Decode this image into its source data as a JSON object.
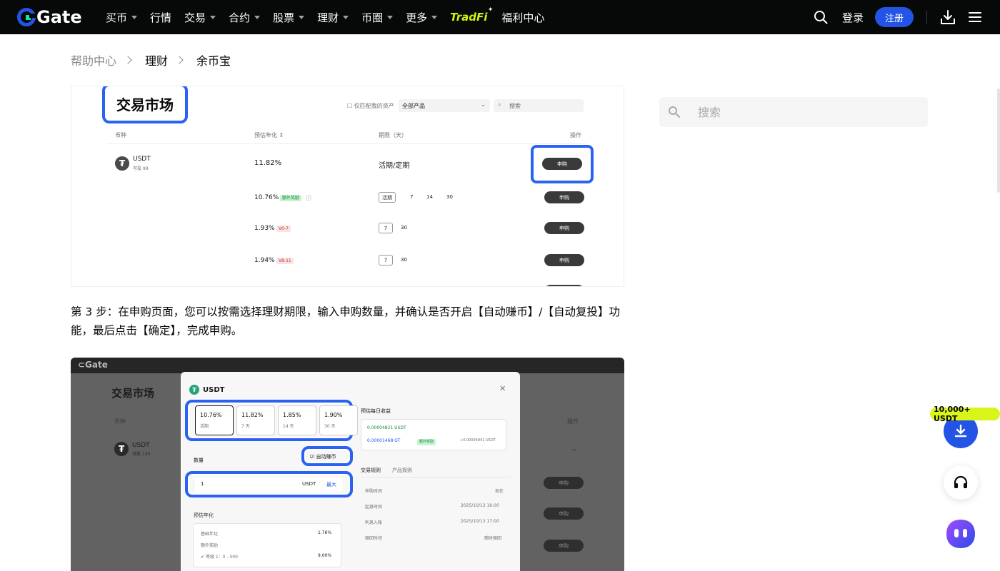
{
  "nav": {
    "logo_text": "Gate",
    "items": [
      {
        "label": "买币",
        "has_caret": true
      },
      {
        "label": "行情",
        "has_caret": false
      },
      {
        "label": "交易",
        "has_caret": true
      },
      {
        "label": "合约",
        "has_caret": true
      },
      {
        "label": "股票",
        "has_caret": true
      },
      {
        "label": "理财",
        "has_caret": true
      },
      {
        "label": "币圈",
        "has_caret": true
      },
      {
        "label": "更多",
        "has_caret": true
      }
    ],
    "tradfi_label": "TradFi",
    "welfare_label": "福利中心",
    "login_label": "登录",
    "register_label": "注册",
    "icons": {
      "search": "search-icon",
      "download": "download-icon",
      "menu": "menu-icon"
    }
  },
  "breadcrumb": [
    "帮助中心",
    "理财",
    "余币宝"
  ],
  "shot1": {
    "callout_title": "交易市场",
    "filter_label": "仅匹配我的资产",
    "filter_select": "全部产品",
    "search_placeholder": "搜索",
    "col_coin": "币种",
    "col_apr": "预估年化 ⇕",
    "col_term": "期限（天）",
    "col_action": "操作",
    "coin_name": "USDT",
    "coin_sub": "可投 99",
    "rows": [
      {
        "apr": "11.82%",
        "tag": "",
        "terms": "活期/定期",
        "action": "申购"
      },
      {
        "apr": "10.76%",
        "tag": "额外奖励",
        "terms": [
          "活期",
          "7",
          "14",
          "30"
        ],
        "action": "申购"
      },
      {
        "apr": "1.93%",
        "tag": "V0-7",
        "terms": [
          "7",
          "30"
        ],
        "action": "申购"
      },
      {
        "apr": "1.94%",
        "tag": "V8-11",
        "terms": [
          "7",
          "30"
        ],
        "action": "申购"
      }
    ]
  },
  "step3_text": "第 3 步：在申购页面，您可以按需选择理财期限，输入申购数量，并确认是否开启【自动赚币】/【自动复投】功能，最后点击【确定】，完成申购。",
  "shot2": {
    "bg_title": "交易市场",
    "modal_coin": "USDT",
    "cards": [
      {
        "value": "10.76%",
        "sub": "活期"
      },
      {
        "value": "11.82%",
        "sub": "7 天"
      },
      {
        "value": "1.85%",
        "sub": "14 天"
      },
      {
        "value": "1.90%",
        "sub": "30 天"
      }
    ],
    "auto_earn_label": "自动赚币",
    "amount_label": "数量",
    "amount_value": "1",
    "amount_unit": "USDT",
    "amount_max": "最大",
    "apr_section": "预估年化",
    "apr_base_label": "基础年化",
    "apr_base_value": "1.76%",
    "apr_extra_label": "额外奖励",
    "apr_tier_label": "等级 1：0 - 500",
    "apr_tier_value": "9.00%",
    "income_title": "预估每日收益",
    "income_1": "0.00004821 USDT",
    "income_2": "0.00001468 GT",
    "income_2_tag": "额外奖励",
    "income_total": "≈0.00004841 USDT",
    "rules_tab1": "交易规则",
    "rules_tab2": "产品规则",
    "rules": [
      {
        "k": "申购时间",
        "v": "现在"
      },
      {
        "k": "起息时间",
        "v": "2025/10/13 16:00"
      },
      {
        "k": "利息入账",
        "v": "2025/10/13 17:00"
      },
      {
        "k": "赎回时间",
        "v": "随时赎回"
      }
    ],
    "bg_coin": "USDT",
    "bg_coin_sub": "可投 130",
    "bg_action": "申购",
    "bg_col_action": "操作",
    "bg_col_coin": "币种"
  },
  "sidebar": {
    "search_placeholder": "搜索"
  },
  "floating": {
    "promo": "10,000+ USDT",
    "icons": [
      "download-icon",
      "headset-icon",
      "chatbot-icon"
    ]
  },
  "colors": {
    "brand": "#2354e6",
    "nav_bg": "#070808",
    "promo": "#d9f51a",
    "tradfi": "#cff20e"
  }
}
